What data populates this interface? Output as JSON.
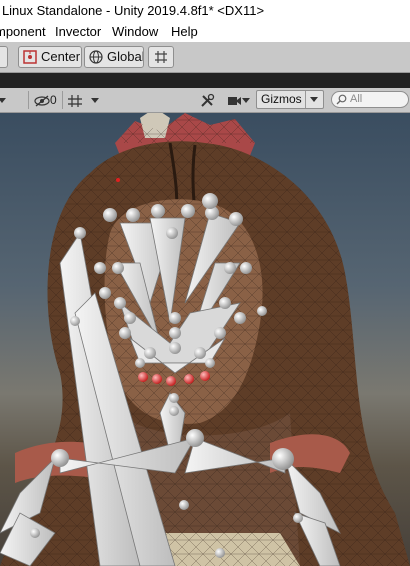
{
  "window": {
    "title": "r Linux Standalone - Unity 2019.4.8f1* <DX11>"
  },
  "menu": {
    "items": [
      "mponent",
      "Invector",
      "Window",
      "Help"
    ]
  },
  "toolbar": {
    "pivot_label": "Center",
    "space_label": "Global"
  },
  "scene_toolbar": {
    "hidden_count": "0",
    "gizmos_label": "Gizmos",
    "search_placeholder": "All"
  }
}
